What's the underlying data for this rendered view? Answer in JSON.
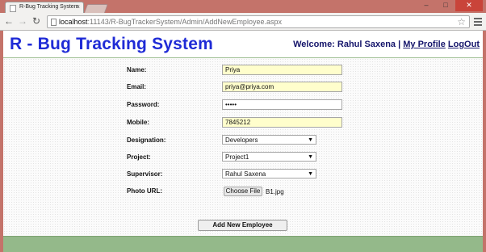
{
  "browser": {
    "tab_title": "R-Bug Tracking System",
    "tab_close": "×",
    "url_host": "localhost",
    "url_path": ":11143/R-BugTrackerSystem/Admin/AddNewEmployee.aspx",
    "window_controls": {
      "minimize": "–",
      "maximize": "□",
      "close": "✕"
    }
  },
  "header": {
    "title": "R - Bug Tracking System",
    "welcome_text": "Welcome: Rahul Saxena |",
    "profile_link": "My Profile",
    "logout_link": "LogOut"
  },
  "form": {
    "name": {
      "label": "Name:",
      "value": "Priya"
    },
    "email": {
      "label": "Email:",
      "value": "priya@priya.com"
    },
    "password": {
      "label": "Password:",
      "value": "12345"
    },
    "mobile": {
      "label": "Mobile:",
      "value": "7845212"
    },
    "designation": {
      "label": "Designation:",
      "selected": "Developers"
    },
    "project": {
      "label": "Project:",
      "selected": "Project1"
    },
    "supervisor": {
      "label": "Supervisor:",
      "selected": "Rahul Saxena"
    },
    "photo": {
      "label": "Photo URL:",
      "button": "Choose File",
      "file_name": "B1.jpg"
    },
    "submit_label": "Add New Employee"
  },
  "colors": {
    "title_blue": "#1f2bd6",
    "user_text": "#15156b",
    "filled_field": "#fffecc",
    "footer_green": "#94b98a",
    "window_frame": "#c4736a"
  }
}
